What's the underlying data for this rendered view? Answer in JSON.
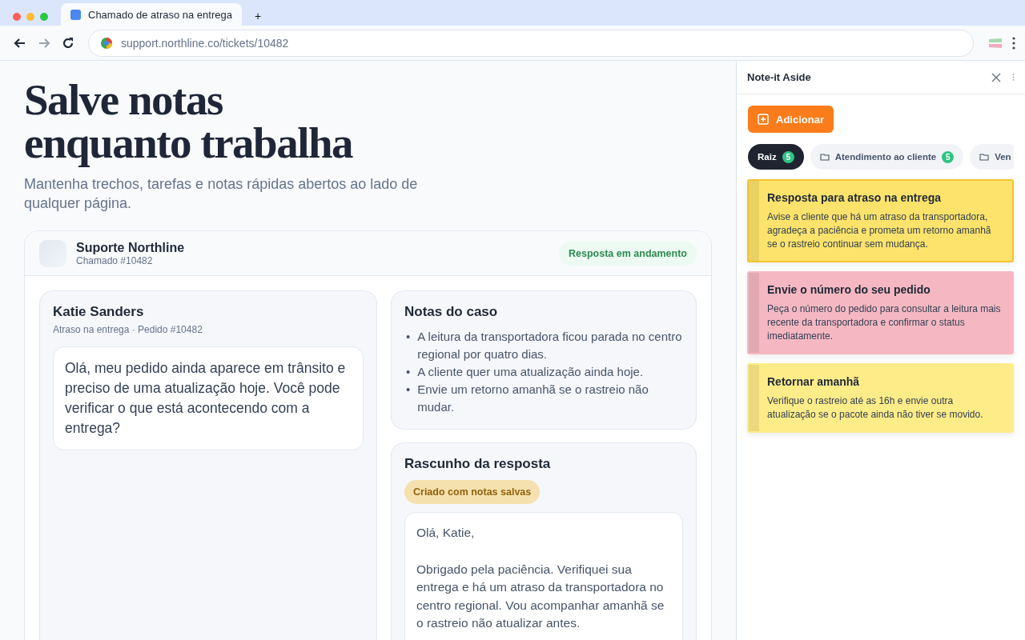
{
  "browser": {
    "tab": {
      "title": "Chamado de atraso na entrega",
      "selected": true
    },
    "new_tab": "+",
    "url": "support.northline.co/tickets/10482"
  },
  "hero": {
    "title_lines": [
      "Salve notas",
      "enquanto trabalha"
    ],
    "subtitle": "Mantenha trechos, tarefas e notas rápidas abertos ao lado de qualquer página."
  },
  "ticket": {
    "brand": "Suporte Northline",
    "number": "Chamado #10482",
    "status": "Resposta em andamento",
    "customer": {
      "name": "Katie Sanders",
      "meta": "Atraso na entrega · Pedido #10482",
      "message": "Olá, meu pedido ainda aparece em trânsito e preciso de uma atualização hoje. Você pode verificar o que está acontecendo com a entrega?"
    },
    "case_notes": {
      "title": "Notas do caso",
      "items": [
        {
          "bullet": "•",
          "text": "A leitura da transportadora ficou parada no centro regional por quatro dias."
        },
        {
          "bullet": "•",
          "text": "A cliente quer uma atualização ainda hoje."
        },
        {
          "bullet": "•",
          "text": "Envie um retorno amanhã se o rastreio não mudar."
        }
      ]
    },
    "draft": {
      "title": "Rascunho da resposta",
      "badge": "Criado com notas salvas",
      "paragraphs": [
        "Olá, Katie,",
        "Obrigado pela paciência. Verifiquei sua entrega e há um atraso da transportadora no centro regional. Vou acompanhar amanhã se o rastreio não atualizar antes."
      ]
    }
  },
  "side_panel": {
    "title": "Note-it Aside",
    "add_button": "Adicionar",
    "folders": [
      {
        "label": "Raiz",
        "count": "5",
        "kind": "root",
        "selected": true
      },
      {
        "label": "Atendimento ao cliente",
        "count": "5",
        "kind": "folder",
        "selected": false
      },
      {
        "label": "Ven",
        "kind": "folder",
        "selected": false
      }
    ],
    "notes": [
      {
        "title": "Resposta para atraso na entrega",
        "body": "Avise a cliente que há um atraso da transportadora, agradeça a paciência e prometa um retorno amanhã se o rastreio continuar sem mudança.",
        "color": "#fde36b",
        "selected": true
      },
      {
        "title": "Envie o número do seu pedido",
        "body": "Peça o número do pedido para consultar a leitura mais recente da transportadora e confirmar o status imediatamente.",
        "color": "#f5b8c2",
        "selected": false
      },
      {
        "title": "Retornar amanhã",
        "body": "Verifique o rastreio até as 16h e envie outra atualização se o pacote ainda não tiver se movido.",
        "color": "#feec88",
        "selected": false
      }
    ]
  }
}
